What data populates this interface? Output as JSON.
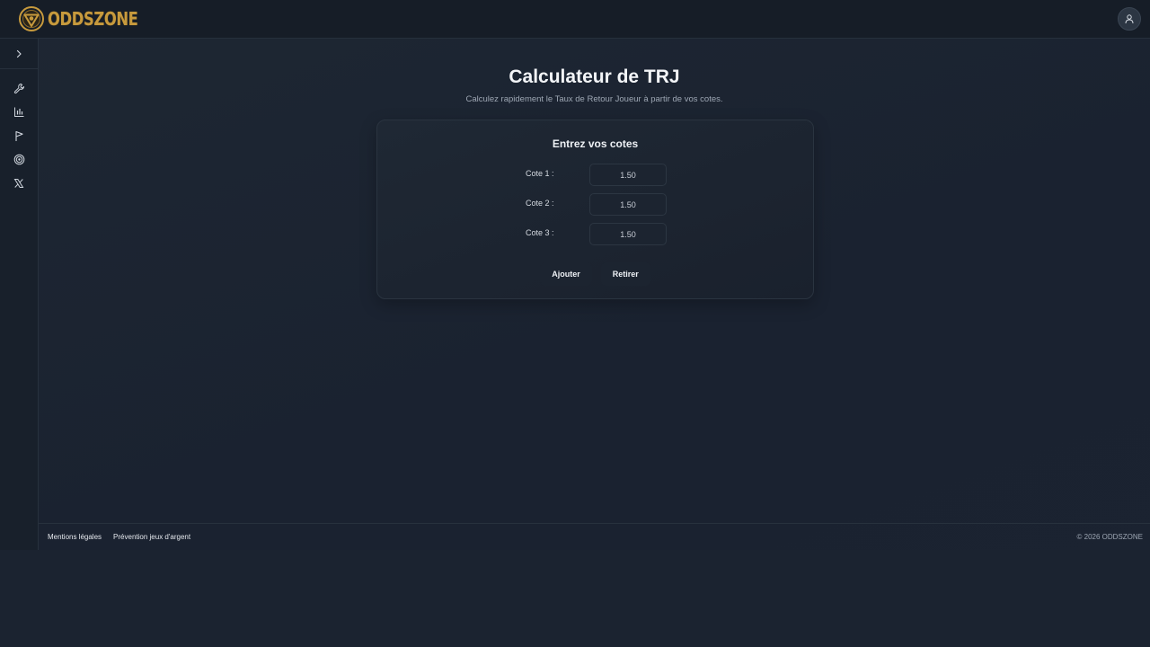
{
  "header": {
    "brand_name": "ODDSZONE",
    "logo_icon": "oddszone-logo-icon",
    "account_icon": "user-icon"
  },
  "sidebar": {
    "toggle_icon": "chevron-right-icon",
    "items": [
      {
        "icon": "wrench-icon"
      },
      {
        "icon": "bar-chart-icon"
      },
      {
        "icon": "flag-icon"
      },
      {
        "icon": "target-icon"
      },
      {
        "icon": "x-logo-icon"
      }
    ]
  },
  "main": {
    "title": "Calculateur de TRJ",
    "subtitle": "Calculez rapidement le Taux de Retour Joueur à partir de vos cotes.",
    "card": {
      "title": "Entrez vos cotes",
      "odds": [
        {
          "label": "Cote 1 :",
          "value": "1.50"
        },
        {
          "label": "Cote 2 :",
          "value": "1.50"
        },
        {
          "label": "Cote 3 :",
          "value": "1.50"
        }
      ],
      "add_label": "Ajouter",
      "remove_label": "Retirer"
    }
  },
  "footer": {
    "links": [
      "Mentions légales",
      "Prévention jeux d'argent"
    ],
    "copyright": "© 2026 ODDSZONE"
  },
  "colors": {
    "brand_gold": "#c79a3d",
    "background": "#1b2330",
    "card": "#1f2834"
  }
}
